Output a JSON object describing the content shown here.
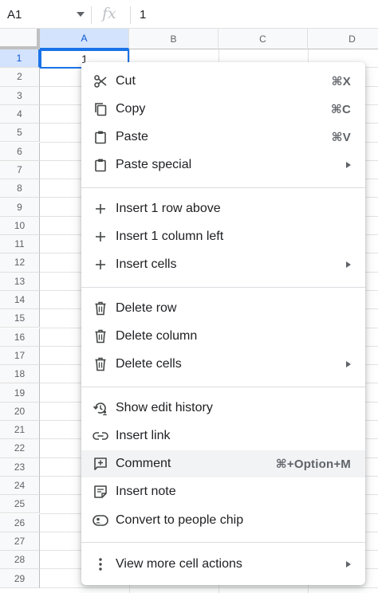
{
  "formula_bar": {
    "name_box": "A1",
    "fx_symbol": "fx",
    "value": "1"
  },
  "columns": [
    "A",
    "B",
    "C",
    "D"
  ],
  "rows": [
    "1",
    "2",
    "3",
    "4",
    "5",
    "6",
    "7",
    "8",
    "9",
    "10",
    "11",
    "12",
    "13",
    "14",
    "15",
    "16",
    "17",
    "18",
    "19",
    "20",
    "21",
    "22",
    "23",
    "24",
    "25",
    "26",
    "27",
    "28",
    "29"
  ],
  "cell_a1": "1",
  "menu": {
    "cut": {
      "label": "Cut",
      "shortcut": "⌘X",
      "icon": "scissors-icon"
    },
    "copy": {
      "label": "Copy",
      "shortcut": "⌘C",
      "icon": "copy-icon"
    },
    "paste": {
      "label": "Paste",
      "shortcut": "⌘V",
      "icon": "clipboard-icon"
    },
    "paste_special": {
      "label": "Paste special",
      "icon": "clipboard-icon"
    },
    "insert_row": {
      "label": "Insert 1 row above",
      "icon": "plus-icon"
    },
    "insert_col": {
      "label": "Insert 1 column left",
      "icon": "plus-icon"
    },
    "insert_cells": {
      "label": "Insert cells",
      "icon": "plus-icon"
    },
    "delete_row": {
      "label": "Delete row",
      "icon": "trash-icon"
    },
    "delete_col": {
      "label": "Delete column",
      "icon": "trash-icon"
    },
    "delete_cells": {
      "label": "Delete cells",
      "icon": "trash-icon"
    },
    "edit_history": {
      "label": "Show edit history",
      "icon": "history-icon"
    },
    "insert_link": {
      "label": "Insert link",
      "icon": "link-icon"
    },
    "comment": {
      "label": "Comment",
      "shortcut": "⌘+Option+M",
      "icon": "comment-icon"
    },
    "insert_note": {
      "label": "Insert note",
      "icon": "note-icon"
    },
    "people_chip": {
      "label": "Convert to people chip",
      "icon": "people-chip-icon"
    },
    "more_actions": {
      "label": "View more cell actions",
      "icon": "more-vert-icon"
    }
  },
  "colors": {
    "selection": "#1a73e8",
    "header_bg": "#f8f9fa",
    "menu_highlight": "#f1f3f4"
  }
}
